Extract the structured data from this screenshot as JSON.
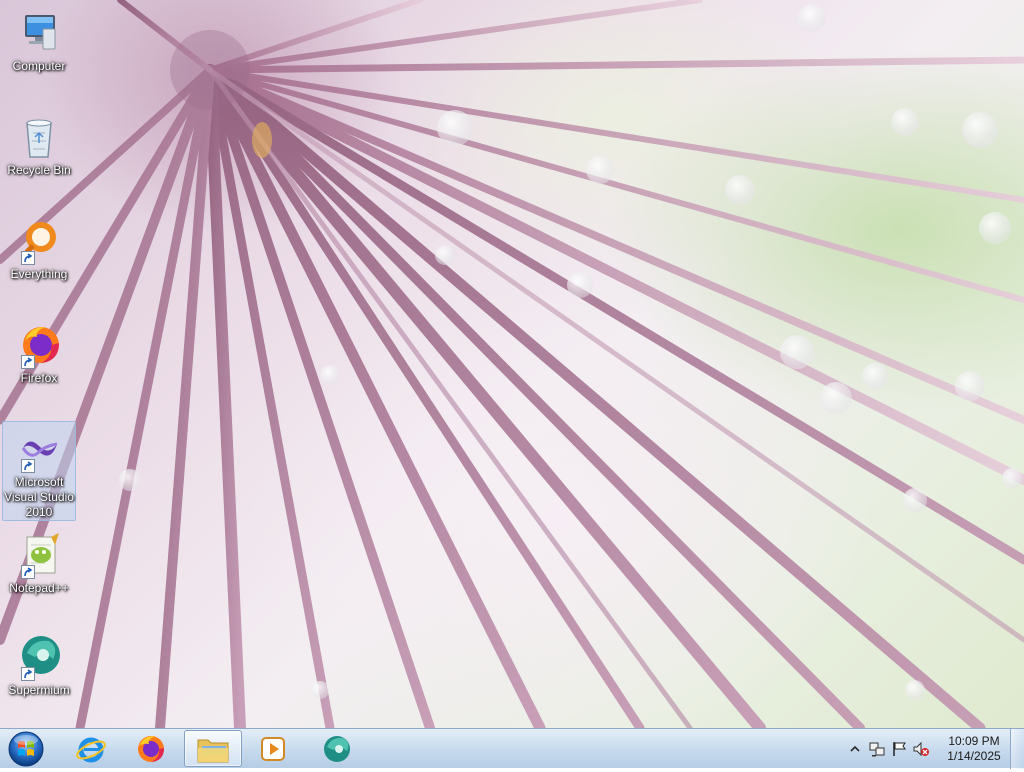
{
  "desktop": {
    "icons": [
      {
        "label": "Computer",
        "icon": "computer-icon",
        "shortcut": false,
        "selected": false
      },
      {
        "label": "Recycle Bin",
        "icon": "recycle-bin-icon",
        "shortcut": false,
        "selected": false
      },
      {
        "label": "Everything",
        "icon": "everything-icon",
        "shortcut": true,
        "selected": false
      },
      {
        "label": "Firefox",
        "icon": "firefox-icon",
        "shortcut": true,
        "selected": false
      },
      {
        "label": "Microsoft Visual Studio 2010",
        "icon": "visual-studio-icon",
        "shortcut": true,
        "selected": true
      },
      {
        "label": "Notepad++",
        "icon": "notepad-plus-plus-icon",
        "shortcut": true,
        "selected": false
      },
      {
        "label": "Supermium",
        "icon": "supermium-icon",
        "shortcut": true,
        "selected": false
      }
    ]
  },
  "taskbar": {
    "start": {
      "icon": "windows-orb-icon"
    },
    "pinned": [
      {
        "icon": "internet-explorer-icon",
        "active": false
      },
      {
        "icon": "firefox-icon",
        "active": false
      },
      {
        "icon": "windows-explorer-icon",
        "active": true
      },
      {
        "icon": "media-player-icon",
        "active": false
      },
      {
        "icon": "supermium-icon",
        "active": false
      }
    ],
    "tray": {
      "icons": [
        "show-hidden-icons-chevron-icon",
        "network-icon",
        "action-center-flag-icon",
        "volume-muted-icon"
      ],
      "time": "10:09 PM",
      "date": "1/14/2025"
    }
  },
  "colors": {
    "taskbar_top": "#e1ecf7",
    "taskbar_bottom": "#b2cae4",
    "selection": "#bed4ee",
    "label_text": "#ffffff"
  }
}
